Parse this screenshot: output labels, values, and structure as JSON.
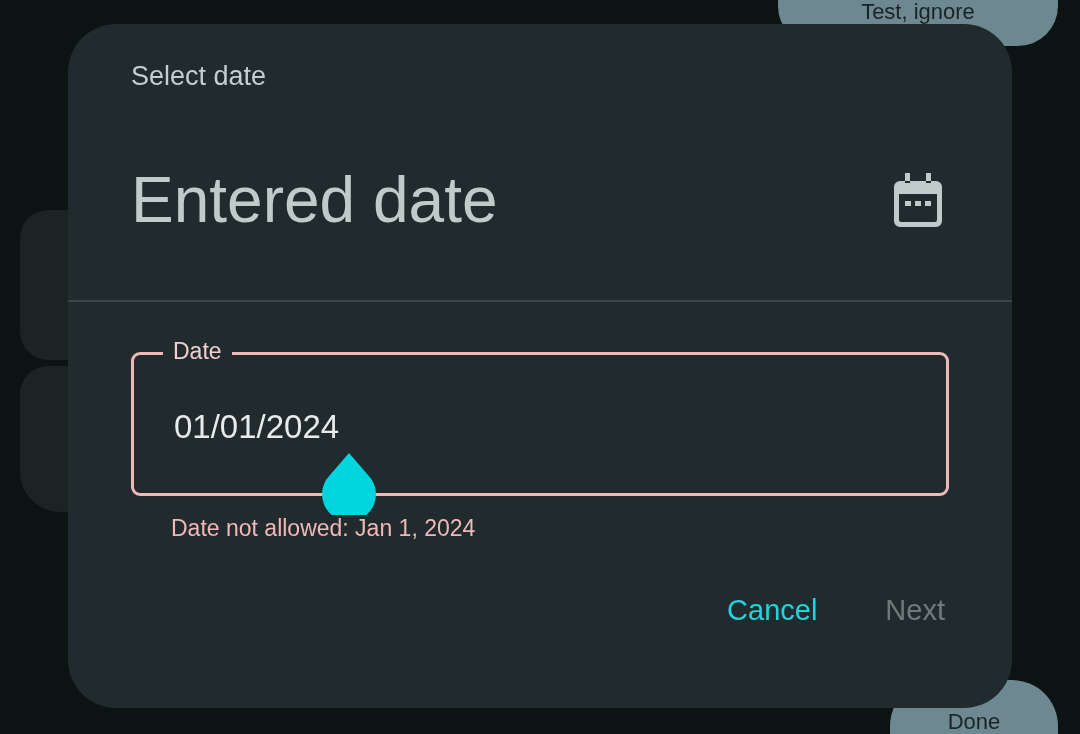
{
  "background": {
    "chips": [
      {
        "label": "Test, ignore"
      },
      {
        "label": "Done"
      }
    ]
  },
  "dialog": {
    "title": "Select date",
    "headline": "Entered date",
    "field": {
      "label": "Date",
      "value": "01/01/2024",
      "error": true,
      "message": "Date not allowed: Jan 1, 2024"
    },
    "buttons": [
      {
        "label": "Cancel",
        "disabled": false
      },
      {
        "label": "Next",
        "disabled": true
      }
    ]
  }
}
